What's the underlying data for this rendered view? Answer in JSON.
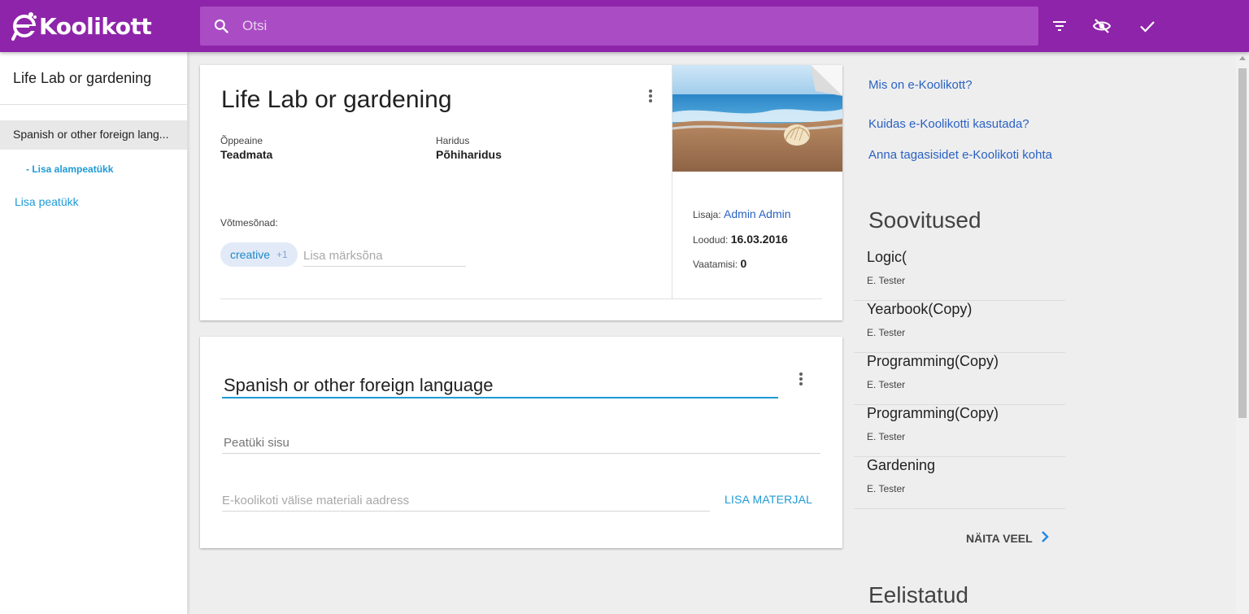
{
  "header": {
    "logo_text": "Koolikott",
    "search_placeholder": "Otsi",
    "icons": [
      "search-icon",
      "filter-icon",
      "visibility-off-icon",
      "check-icon"
    ],
    "brand_color": "#8e24aa"
  },
  "sidebar": {
    "title": "Life Lab or gardening",
    "active_item": "Spanish or other foreign lang...",
    "sub_add": "- Lisa alampeatükk",
    "add_chapter": "Lisa peatükk"
  },
  "material": {
    "title": "Life Lab or gardening",
    "subject_label": "Õppeaine",
    "subject_value": "Teadmata",
    "education_label": "Haridus",
    "education_value": "Põhiharidus",
    "keywords_label": "Võtmesõnad:",
    "keyword_chip": "creative",
    "keyword_more": "+1",
    "keyword_placeholder": "Lisa märksõna",
    "added_by_label": "Lisaja:",
    "added_by_value": "Admin Admin",
    "created_label": "Loodud:",
    "created_value": "16.03.2016",
    "views_label": "Vaatamisi:",
    "views_value": "0"
  },
  "chapter": {
    "title": "Spanish or other foreign language",
    "content_placeholder": "Peatüki sisu",
    "url_placeholder": "E-koolikoti välise materiali aadress",
    "add_material": "LISA MATERJAL"
  },
  "right": {
    "links": [
      "Mis on e-Koolikott?",
      "Kuidas e-Koolikotti kasutada?",
      "Anna tagasisidet e-Koolikoti kohta"
    ],
    "recommendations_heading": "Soovitused",
    "recommendations": [
      {
        "title": "Logic(",
        "author": "E. Tester"
      },
      {
        "title": "Yearbook(Copy)",
        "author": "E. Tester"
      },
      {
        "title": "Programming(Copy)",
        "author": "E. Tester"
      },
      {
        "title": "Programming(Copy)",
        "author": "E. Tester"
      },
      {
        "title": "Gardening",
        "author": "E. Tester"
      }
    ],
    "show_more": "NÄITA VEEL",
    "preferred_heading": "Eelistatud"
  }
}
